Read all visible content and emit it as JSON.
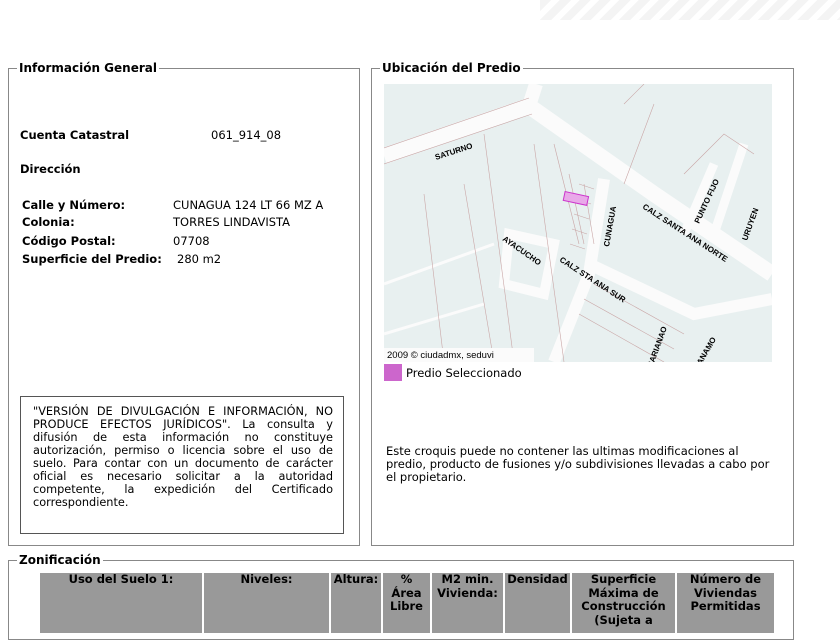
{
  "general": {
    "title": "Información General",
    "cuenta_label": "Cuenta Catastral",
    "cuenta_value": "061_914_08",
    "direccion_label": "Dirección",
    "calle_label": "Calle y Número:",
    "calle_value": "CUNAGUA 124 LT 66 MZ A",
    "colonia_label": "Colonia:",
    "colonia_value": "TORRES LINDAVISTA",
    "cp_label": "Código Postal:",
    "cp_value": "07708",
    "superficie_label": "Superficie del Predio:",
    "superficie_value": "280 m2",
    "disclaimer": "\"VERSIÓN DE DIVULGACIÓN E INFORMACIÓN, NO PRODUCE EFECTOS JURÍDICOS\". La consulta y difusión de esta información no constituye autorización, permiso o licencia sobre el uso de suelo. Para contar con un documento de carácter oficial es necesario solicitar a la autoridad competente, la expedición del Certificado correspondiente."
  },
  "ubicacion": {
    "title": "Ubicación del Predio",
    "streets": {
      "saturno": "SATURNO",
      "cunagua": "CUNAGUA",
      "santa_ana_norte": "CALZ SANTA ANA NORTE",
      "punto_fijo": "PUNTO FIJO",
      "uruyen": "URUYEN",
      "ayacucho": "AYACUCHO",
      "sta_ana_sur": "CALZ STA ANA SUR",
      "marianao": "MARIANAO",
      "guantanamo": "TANAMO"
    },
    "copyright": "2009 © ciudadmx, seduvi",
    "legend": "Predio Seleccionado",
    "legend_color": "#cc66cc",
    "note": "Este croquis puede no contener las ultimas modificaciones al predio, producto de fusiones y/o subdivisiones llevadas a cabo por el propietario."
  },
  "zonificacion": {
    "title": "Zonificación",
    "headers": [
      "Uso del Suelo 1:",
      "Niveles:",
      "Altura:",
      "% Área Libre",
      "M2 min. Vivienda:",
      "Densidad",
      "Superficie Máxima de Construcción (Sujeta a",
      "Número de Viviendas Permitidas"
    ]
  }
}
